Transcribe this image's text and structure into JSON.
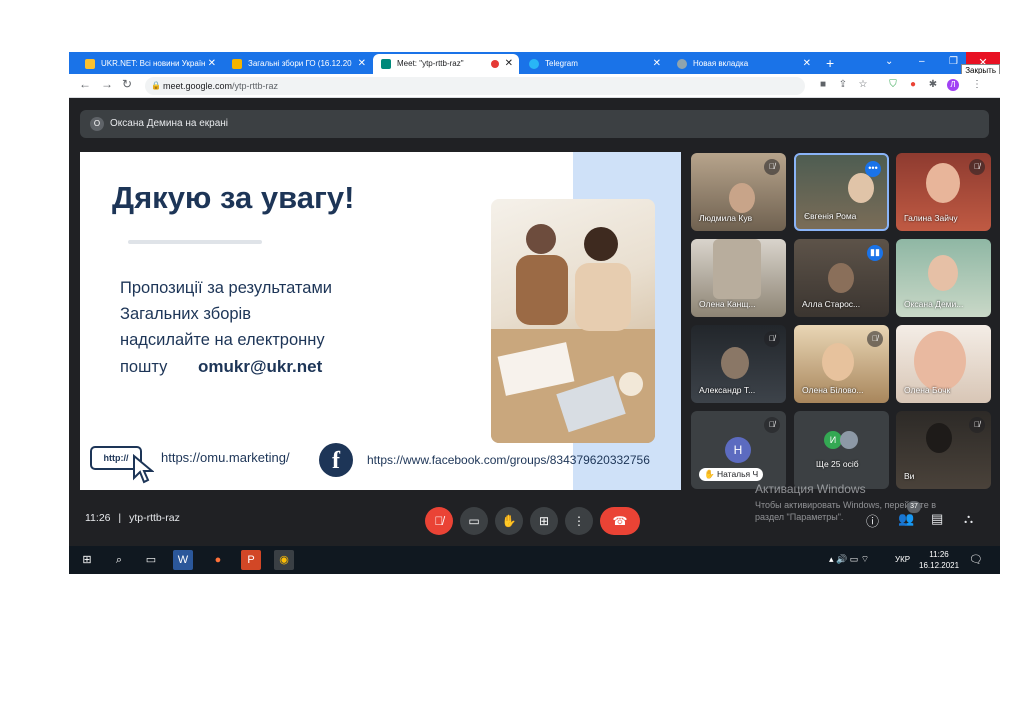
{
  "browser": {
    "tabs": [
      {
        "label": "UKR.NET: Всі новини Україн",
        "favicon_color": "#fbc02d"
      },
      {
        "label": "Загальні збори ГО (16.12.20",
        "favicon_color": "#f4b400"
      },
      {
        "label": "Meet: \"ytp-rttb-raz\"",
        "favicon_color": "#00897b",
        "active": true
      },
      {
        "label": "Telegram",
        "favicon_color": "#29b6f6"
      },
      {
        "label": "Новая вкладка",
        "favicon_color": "#90a4ae"
      }
    ],
    "close_tooltip": "Закрыть",
    "url_host": "meet.google.com",
    "url_path": "/ytp-rttb-raz",
    "profile_initial": "Л"
  },
  "meet": {
    "presenter_initial": "О",
    "presenter_text": "Оксана Демина на екрані",
    "slide": {
      "title": "Дякую за увагу!",
      "lines": [
        "Пропозиції за результатами",
        "Загальних зборів",
        "надсилайте на електронну",
        "пошту"
      ],
      "email": "omukr@ukr.net",
      "http_label": "http://",
      "website": "https://omu.marketing/",
      "facebook_letter": "f",
      "facebook_url": "https://www.facebook.com/groups/834379620332756"
    },
    "participants": [
      {
        "name": "Людмила Кув",
        "muted": true
      },
      {
        "name": "Євгенія Рома",
        "muted": false,
        "more": "•••"
      },
      {
        "name": "Галина Зайчу",
        "muted": true
      },
      {
        "name": "Олена Канщ...",
        "muted": false
      },
      {
        "name": "Алла Старос...",
        "muted": false,
        "speaking": true
      },
      {
        "name": "Оксана Деми...",
        "muted": false
      },
      {
        "name": "Александр Т...",
        "muted": true
      },
      {
        "name": "Олена Білово...",
        "muted": true
      },
      {
        "name": "Олена Бочк",
        "muted": false
      },
      {
        "name": "Наталья Ч",
        "muted": true,
        "initial": "Н",
        "hand": "✋"
      },
      {
        "name": "Ще 25 осіб",
        "initial": "И"
      },
      {
        "name": "Ви",
        "muted": true
      }
    ],
    "time": "11:26",
    "separator": "|",
    "meeting_code": "ytp-rttb-raz",
    "activation_title": "Активация Windows",
    "activation_text_1": "Чтобы активировать Windows, перейдите в",
    "activation_text_2": "раздел \"Параметры\".",
    "people_count": "37"
  },
  "taskbar": {
    "lang": "УКР",
    "clock_time": "11:26",
    "clock_date": "16.12.2021"
  }
}
